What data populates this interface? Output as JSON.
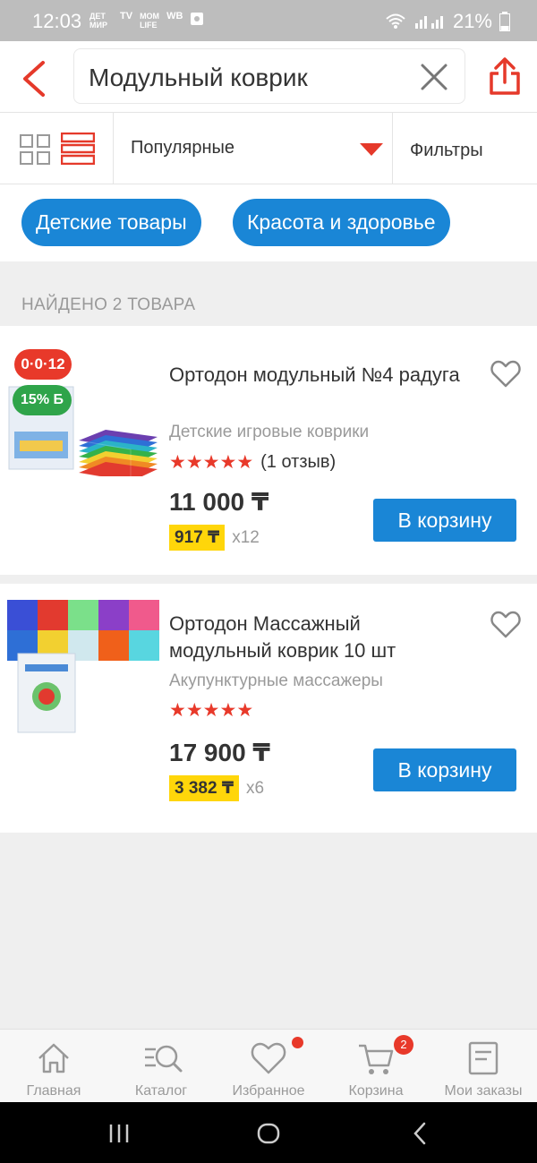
{
  "status_bar": {
    "time": "12:03",
    "notif_icons": [
      "ДЕТ МИР",
      "TV",
      "MOM LIFE",
      "WB"
    ],
    "battery": "21%"
  },
  "header": {
    "back_icon": "chevron-left-icon",
    "search_value": "Модульный коврик",
    "clear_icon": "close-icon",
    "share_icon": "share-icon"
  },
  "sort_bar": {
    "sort_label": "Популярные",
    "filter_label": "Фильтры"
  },
  "chips": [
    "Детские товары",
    "Красота и здоровье"
  ],
  "found_text": "НАЙДЕНО 2 ТОВАРА",
  "products": [
    {
      "name": "Ортодон модульный №4 радуга",
      "category": "Детские игровые коврики",
      "rating_stars": 5,
      "reviews": "(1 отзыв)",
      "price": "11 000 ₸",
      "installment": "917 ₸",
      "installment_mult": "x12",
      "cart_label": "В корзину",
      "age_badge": "0·0·12",
      "bonus_badge": "15% Б"
    },
    {
      "name": "Ортодон Массажный модульный коврик 10 шт",
      "category": "Акупунктурные массажеры",
      "rating_stars": 5,
      "reviews": "",
      "price": "17 900 ₸",
      "installment": "3 382 ₸",
      "installment_mult": "x6",
      "cart_label": "В корзину"
    }
  ],
  "bottom_nav": [
    {
      "label": "Главная",
      "icon": "home-icon"
    },
    {
      "label": "Каталог",
      "icon": "catalog-search-icon"
    },
    {
      "label": "Избранное",
      "icon": "heart-icon"
    },
    {
      "label": "Корзина",
      "icon": "cart-icon",
      "count": "2"
    },
    {
      "label": "Мои заказы",
      "icon": "orders-icon"
    }
  ],
  "colors": {
    "accent_red": "#e8392a",
    "primary_blue": "#1a86d6",
    "installment_yellow": "#ffd60a",
    "bonus_green": "#2fa44a"
  }
}
